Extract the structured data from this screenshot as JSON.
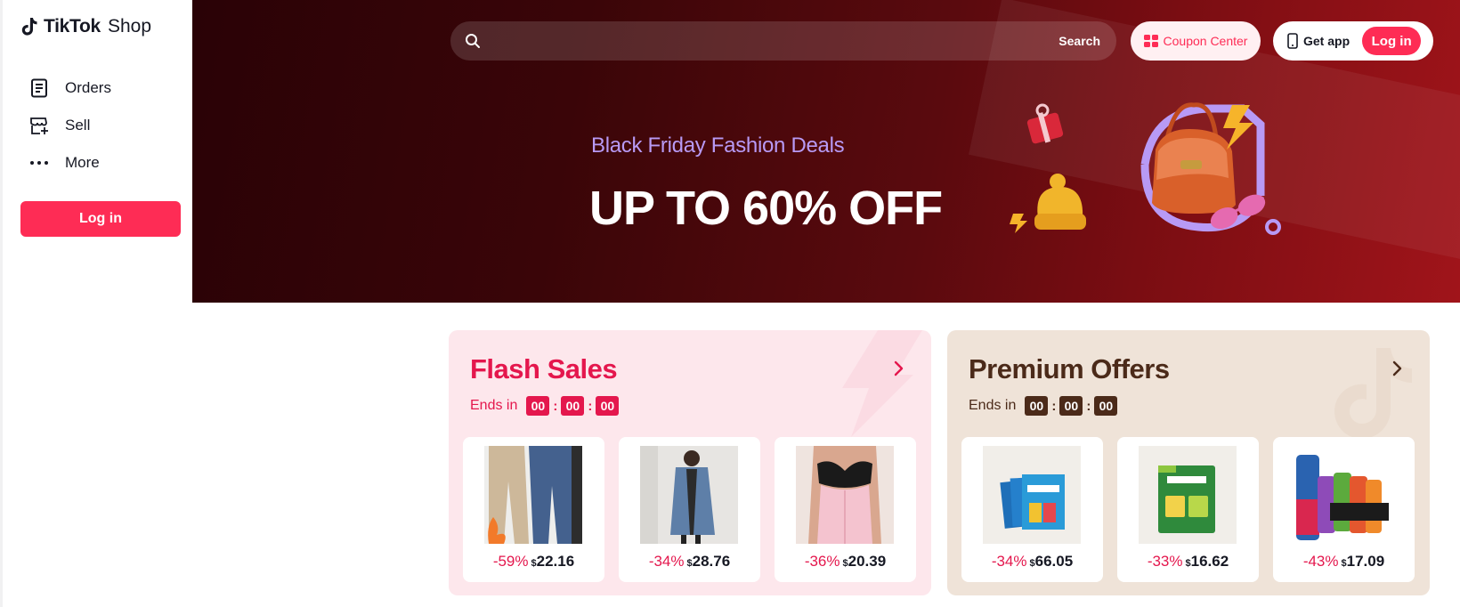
{
  "brand": {
    "name": "TikTok",
    "suffix": "Shop"
  },
  "sidebar": {
    "items": [
      {
        "label": "Orders",
        "icon": "orders-icon"
      },
      {
        "label": "Sell",
        "icon": "store-add-icon"
      },
      {
        "label": "More",
        "icon": "more-dots-icon"
      }
    ],
    "login_label": "Log in"
  },
  "header": {
    "search": {
      "placeholder": "",
      "button_label": "Search"
    },
    "coupon_label": "Coupon Center",
    "getapp_label": "Get app",
    "login_label": "Log in"
  },
  "hero": {
    "subtitle": "Black Friday Fashion Deals",
    "title": "UP TO 60% OFF"
  },
  "flash_sales": {
    "title": "Flash Sales",
    "ends_label": "Ends in",
    "timer": [
      "00",
      "00",
      "00"
    ],
    "items": [
      {
        "discount": "-59%",
        "currency": "$",
        "price": "22.16",
        "image": "jeans-product"
      },
      {
        "discount": "-34%",
        "currency": "$",
        "price": "28.76",
        "image": "denim-coat-product"
      },
      {
        "discount": "-36%",
        "currency": "$",
        "price": "20.39",
        "image": "corset-product"
      }
    ]
  },
  "premium_offers": {
    "title": "Premium Offers",
    "ends_label": "Ends in",
    "timer": [
      "00",
      "00",
      "00"
    ],
    "items": [
      {
        "discount": "-34%",
        "currency": "$",
        "price": "66.05",
        "image": "liquid-iv-blue-product"
      },
      {
        "discount": "-33%",
        "currency": "$",
        "price": "16.62",
        "image": "liquid-iv-green-product"
      },
      {
        "discount": "-43%",
        "currency": "$",
        "price": "17.09",
        "image": "ryse-cans-product"
      }
    ]
  },
  "colors": {
    "accent": "#fe2c55",
    "flash": "#e4174d",
    "premium": "#4b2a19"
  }
}
